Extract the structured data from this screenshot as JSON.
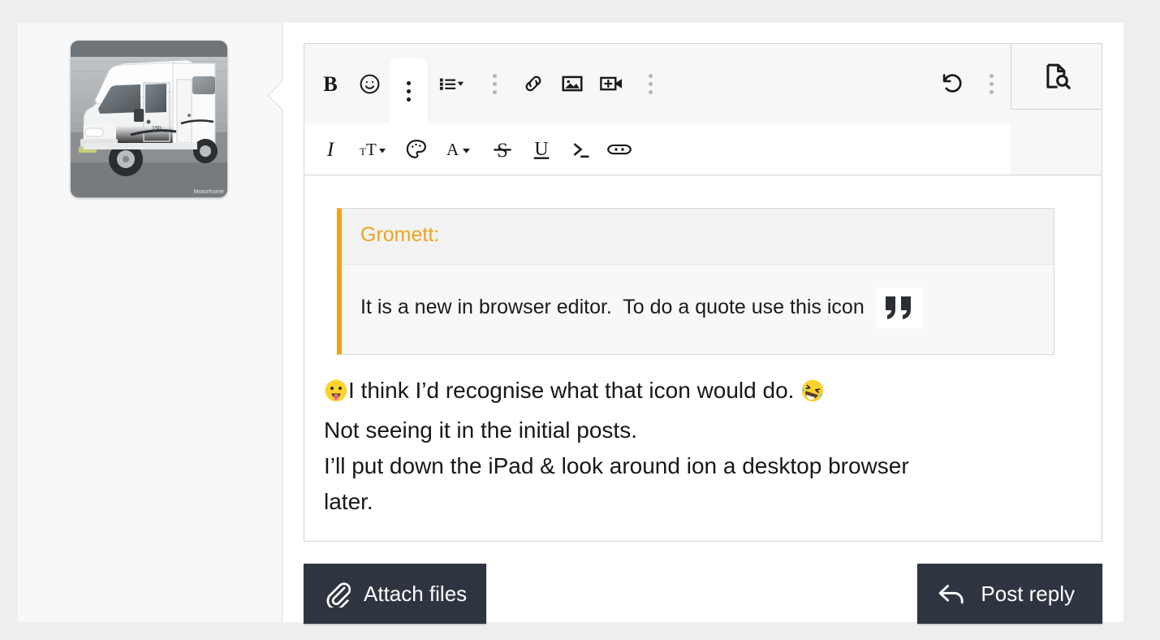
{
  "avatar": {
    "alt_label": "motorhome-photo",
    "watermark": "Motorhome"
  },
  "toolbar": {
    "row_one": [
      {
        "name": "bold-button",
        "label": "B"
      },
      {
        "name": "emoji-button",
        "label": "Emoji"
      },
      {
        "name": "more-options-button-1",
        "label": "More"
      },
      {
        "name": "bullet-list-button",
        "label": "List"
      },
      {
        "name": "more-options-button-2",
        "label": "More"
      },
      {
        "name": "link-button",
        "label": "Link"
      },
      {
        "name": "image-button",
        "label": "Image"
      },
      {
        "name": "video-button",
        "label": "Video"
      },
      {
        "name": "more-options-button-3",
        "label": "More"
      },
      {
        "name": "undo-button",
        "label": "Undo"
      },
      {
        "name": "more-options-button-4",
        "label": "More"
      }
    ],
    "row_two": [
      {
        "name": "italic-button",
        "label": "I"
      },
      {
        "name": "font-size-button",
        "label": "Font size"
      },
      {
        "name": "highlight-color-button",
        "label": "Highlight"
      },
      {
        "name": "text-color-button",
        "label": "Text color"
      },
      {
        "name": "strikethrough-button",
        "label": "S"
      },
      {
        "name": "underline-button",
        "label": "U"
      },
      {
        "name": "code-button",
        "label": "Code"
      },
      {
        "name": "spoiler-button",
        "label": "Spoiler"
      }
    ],
    "preview_label": "Preview"
  },
  "quote": {
    "author": "Gromett:",
    "text": "It is a new in browser editor.  To do a quote use this icon",
    "icon_label": "quote-glyph"
  },
  "post": {
    "emoji_start": "😛",
    "line1_a": "I think I’d recognise what that icon would do. ",
    "emoji_end": "🤣",
    "line2": "Not seeing it in the initial posts.",
    "line3": "I’ll put down the iPad & look around ion a desktop browser",
    "line4": "later."
  },
  "actions": {
    "attach_label": "Attach files",
    "post_label": "Post reply"
  },
  "colors": {
    "quote_accent": "#efa31d",
    "button_bg": "#2f3540",
    "page_bg": "#eeeeee"
  }
}
